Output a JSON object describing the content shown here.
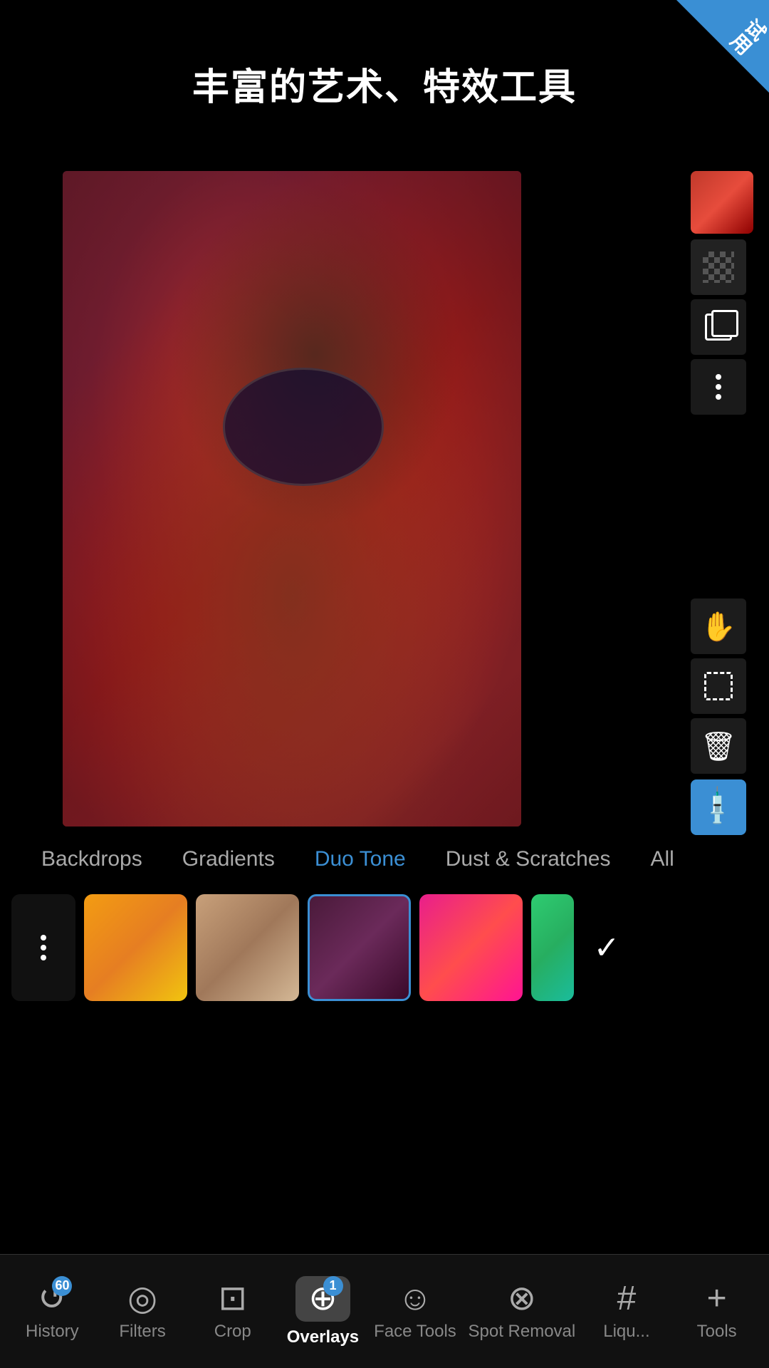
{
  "app": {
    "title": "丰富的艺术、特效工具",
    "badge_text": "试用"
  },
  "corner_badge": {
    "text": "试用"
  },
  "right_toolbar_top": [
    {
      "id": "color-swatch",
      "label": "Color Swatch",
      "type": "color"
    },
    {
      "id": "checker",
      "label": "Checker",
      "type": "checker"
    },
    {
      "id": "copy",
      "label": "Copy Layer",
      "type": "copy"
    },
    {
      "id": "more",
      "label": "More Options",
      "type": "more"
    }
  ],
  "right_toolbar_bottom": [
    {
      "id": "hand",
      "label": "Hand Tool",
      "type": "hand"
    },
    {
      "id": "select",
      "label": "Select Tool",
      "type": "select"
    },
    {
      "id": "delete",
      "label": "Delete",
      "type": "delete"
    },
    {
      "id": "eyedropper",
      "label": "Eyedropper",
      "type": "eyedropper"
    }
  ],
  "category_tabs": [
    {
      "id": "backdrops",
      "label": "Backdrops",
      "active": false
    },
    {
      "id": "gradients",
      "label": "Gradients",
      "active": false
    },
    {
      "id": "duo-tone",
      "label": "Duo Tone",
      "active": true
    },
    {
      "id": "dust-scratches",
      "label": "Dust & Scratches",
      "active": false
    },
    {
      "id": "all",
      "label": "All",
      "active": false
    }
  ],
  "swatches": [
    {
      "id": "dots-menu",
      "type": "dots"
    },
    {
      "id": "orange",
      "type": "orange"
    },
    {
      "id": "brown",
      "type": "brown"
    },
    {
      "id": "dark-red",
      "type": "dark-red",
      "selected": true
    },
    {
      "id": "pink-red",
      "type": "pink-red"
    },
    {
      "id": "green-partial",
      "type": "green-partial"
    }
  ],
  "bottom_nav": [
    {
      "id": "history",
      "label": "History",
      "badge": "60",
      "icon": "history"
    },
    {
      "id": "filters",
      "label": "Filters",
      "badge": null,
      "icon": "filters"
    },
    {
      "id": "crop",
      "label": "Crop",
      "badge": null,
      "icon": "crop"
    },
    {
      "id": "overlays",
      "label": "Overlays",
      "badge": "1",
      "icon": "overlays",
      "active": true
    },
    {
      "id": "face-tools",
      "label": "Face Tools",
      "badge": null,
      "icon": "face"
    },
    {
      "id": "spot-removal",
      "label": "Spot Removal",
      "badge": null,
      "icon": "spot"
    },
    {
      "id": "liquify",
      "label": "Liqu...",
      "badge": null,
      "icon": "liquify"
    },
    {
      "id": "tools",
      "label": "Tools",
      "badge": null,
      "icon": "tools"
    }
  ]
}
